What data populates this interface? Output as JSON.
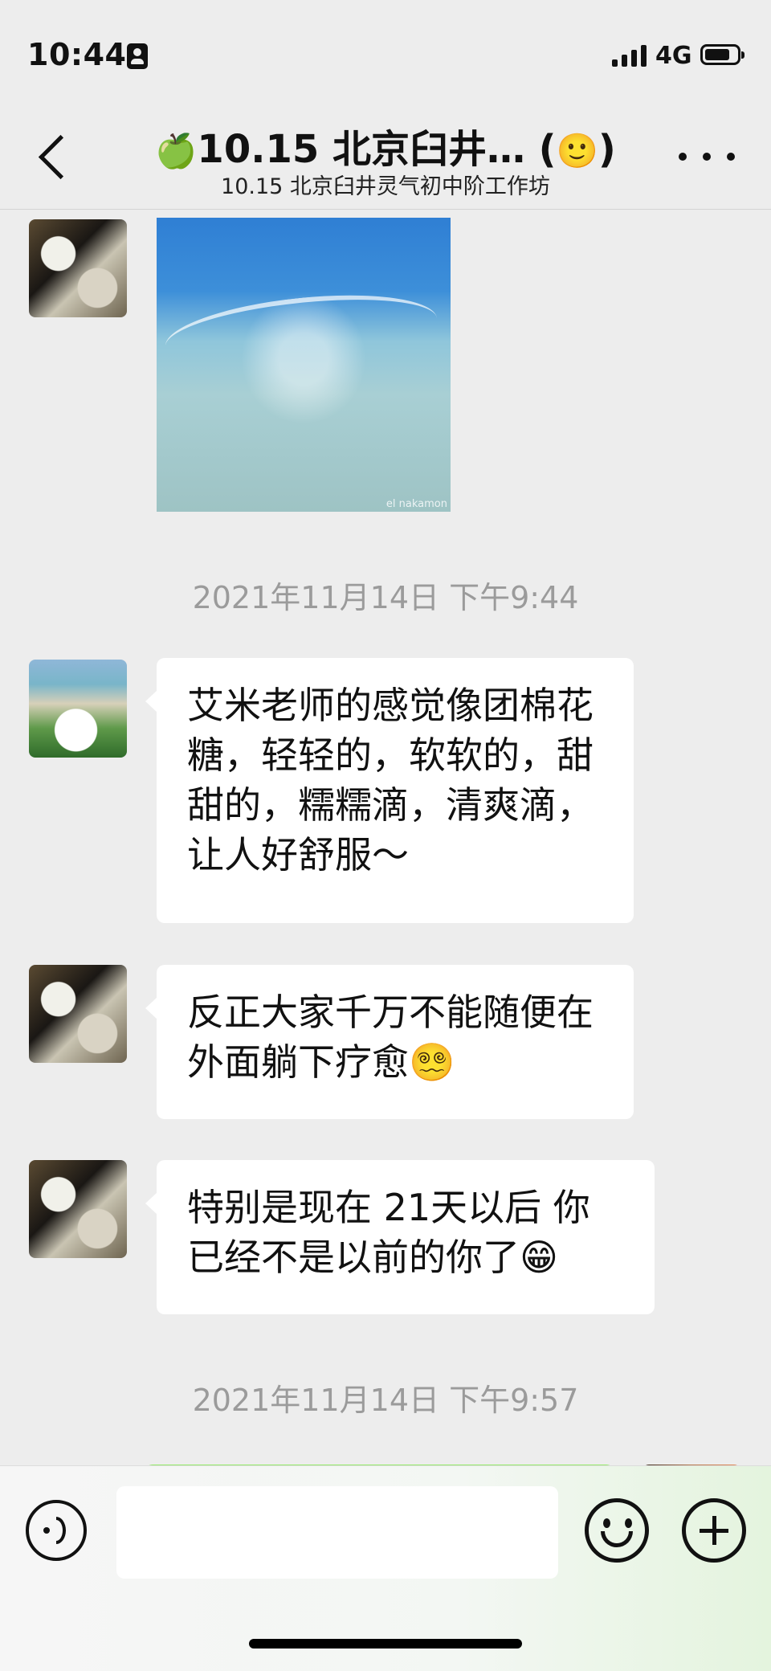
{
  "status_bar": {
    "time": "10:44",
    "network": "4G",
    "icons": [
      "id-card-icon",
      "signal-icon",
      "battery-icon"
    ]
  },
  "nav": {
    "title_icon": "🍏",
    "title": "10.15 北京臼井…",
    "title_suffix_icon": "🙂",
    "subtitle": "10.15 北京臼井灵气初中阶工作坊",
    "icons": [
      "back-icon",
      "more-icon"
    ]
  },
  "messages": {
    "timestamp_1": "2021年11月14日 下午9:44",
    "text_1": "艾米老师的感觉像团棉花糖，轻轻的，软软的，甜甜的，糯糯滴，清爽滴，让人好舒服～",
    "text_2": "反正大家千万不能随便在外面躺下疗愈😵‍💫",
    "text_3": "特别是现在 21天以后 你已经不是以前的你了😁",
    "timestamp_2": "2021年11月14日 下午9:57",
    "photo_watermark": "el nakamon"
  },
  "input_bar": {
    "value": "",
    "icons": [
      "voice-icon",
      "emoji-icon",
      "plus-icon"
    ]
  },
  "colors": {
    "background": "#ededed",
    "bubble_incoming": "#ffffff",
    "bubble_outgoing": "#95ec69",
    "timestamp": "#9b9b9b"
  }
}
